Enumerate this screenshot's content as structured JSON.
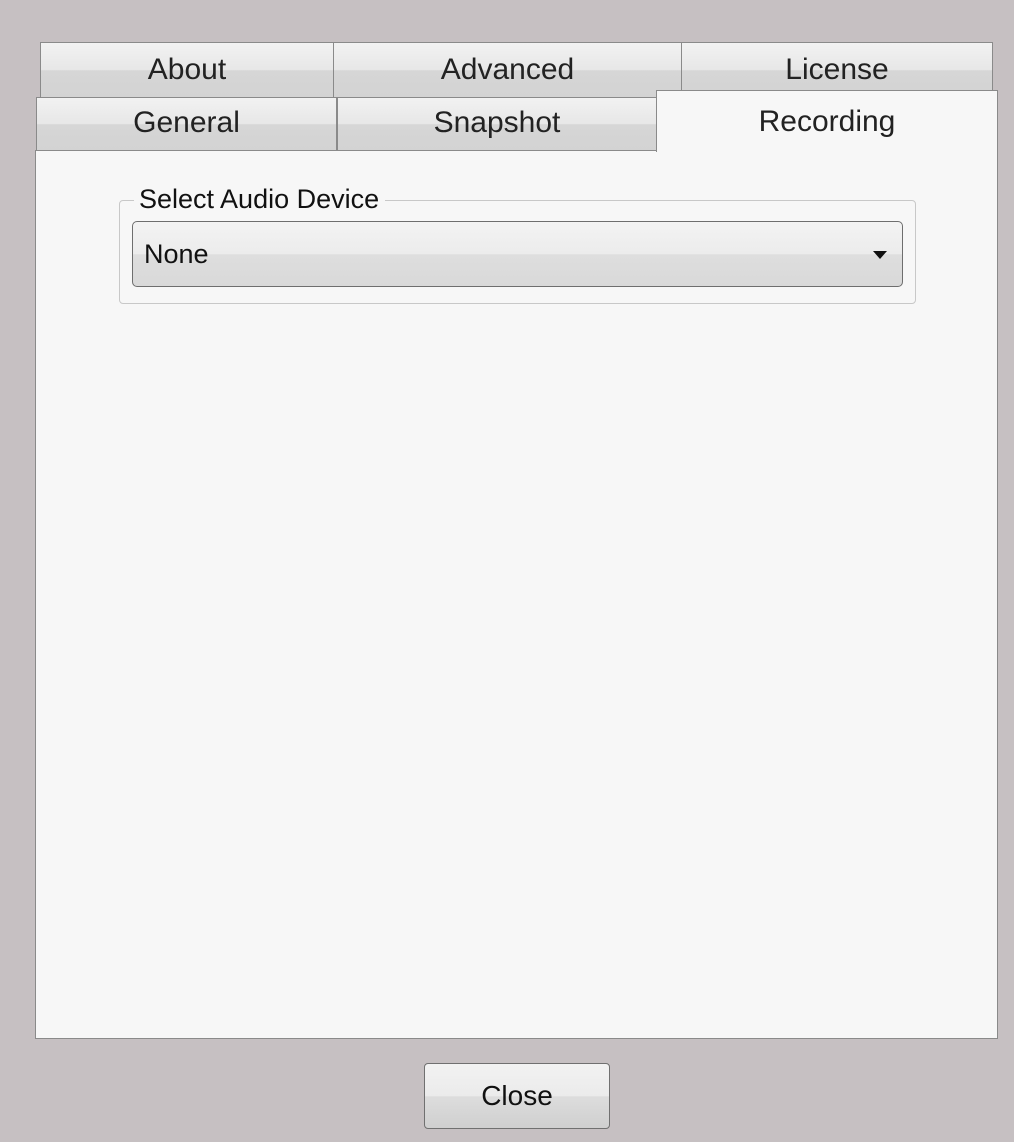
{
  "tabs": {
    "row_back": [
      {
        "id": "about",
        "label": "About"
      },
      {
        "id": "advanced",
        "label": "Advanced"
      },
      {
        "id": "license",
        "label": "License"
      }
    ],
    "row_front": [
      {
        "id": "general",
        "label": "General"
      },
      {
        "id": "snapshot",
        "label": "Snapshot"
      },
      {
        "id": "recording",
        "label": "Recording",
        "selected": true
      }
    ]
  },
  "recording": {
    "audio_group_title": "Select Audio Device",
    "audio_device_value": "None",
    "dropdown_icon": "chevron-down-icon"
  },
  "footer": {
    "close_label": "Close"
  }
}
